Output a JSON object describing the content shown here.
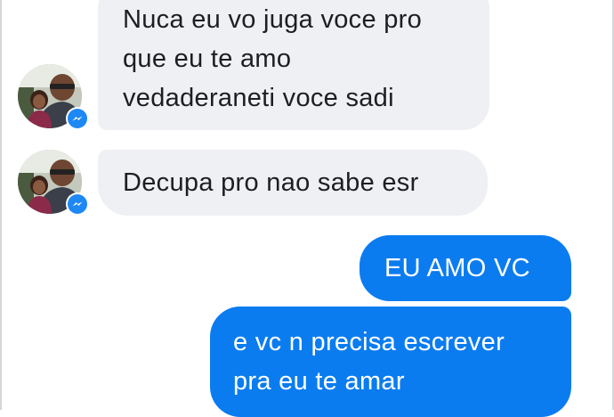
{
  "conversation": {
    "incoming": [
      {
        "lines": [
          "Nuca eu vo juga voce pro",
          "que eu te amo",
          "vedaderaneti voce sadi"
        ]
      },
      {
        "lines": [
          "Decupa pro nao sabe esr"
        ]
      }
    ],
    "outgoing": [
      {
        "lines": [
          "EU AMO VC"
        ]
      },
      {
        "lines": [
          "e vc n precisa escrever",
          "pra eu te amar"
        ]
      }
    ]
  },
  "avatar": {
    "icon": "profile-photo",
    "badge_icon": "messenger-icon"
  },
  "colors": {
    "incoming_bubble": "#eef0f3",
    "outgoing_bubble": "#0a7cf0",
    "messenger_badge": "#1e88f5",
    "background": "#ffffff"
  }
}
